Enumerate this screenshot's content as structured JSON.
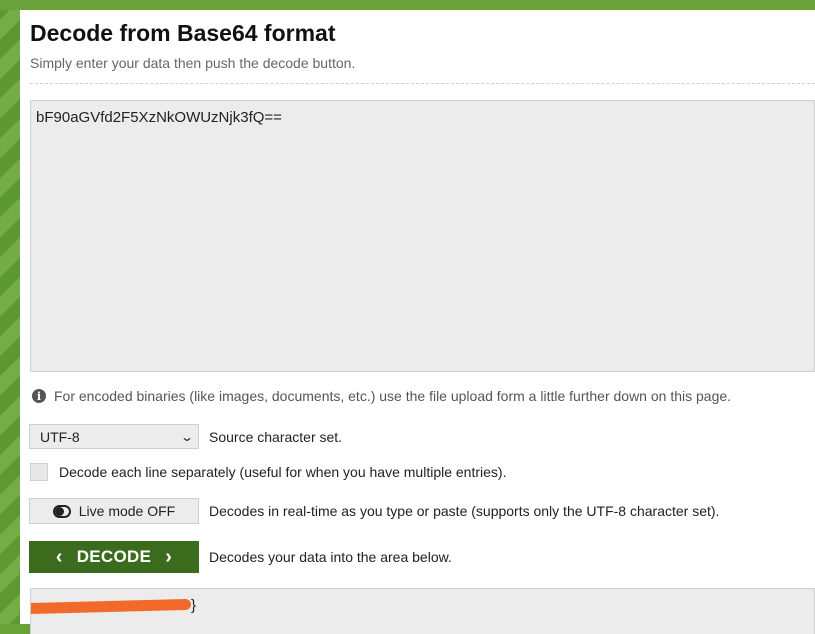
{
  "header": {
    "title": "Decode from Base64 format",
    "subtitle": "Simply enter your data then push the decode button."
  },
  "input": {
    "value": "bF90aGVfd2F5XzNkOWUzNjk3fQ=="
  },
  "info": {
    "text": "For encoded binaries (like images, documents, etc.) use the file upload form a little further down on this page."
  },
  "charset": {
    "selected": "UTF-8",
    "label": "Source character set."
  },
  "line_option": {
    "label": "Decode each line separately (useful for when you have multiple entries)."
  },
  "live_mode": {
    "button_label": "Live mode OFF",
    "description": "Decodes in real-time as you type or paste (supports only the UTF-8 character set)."
  },
  "decode": {
    "button_label": "DECODE",
    "description": "Decodes your data into the area below."
  },
  "output": {
    "visible_text": "}"
  },
  "colors": {
    "accent_green": "#3b6b1d",
    "background_green": "#6aa23a",
    "redaction": "#f26a2a"
  }
}
